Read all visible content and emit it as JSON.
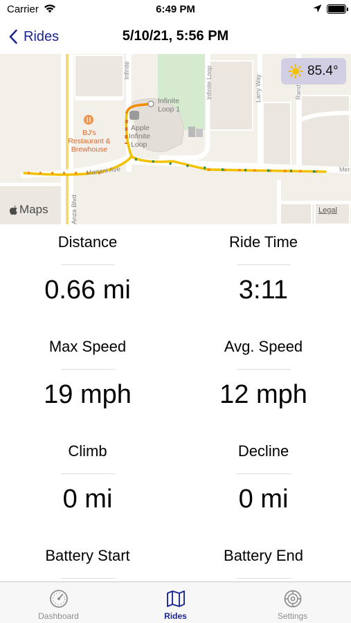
{
  "status_bar": {
    "carrier": "Carrier",
    "time": "6:49 PM",
    "icons": [
      "wifi-icon",
      "location-arrow-icon",
      "battery-icon"
    ]
  },
  "nav": {
    "back_label": "Rides",
    "title": "5/10/21, 5:56 PM",
    "accent_color": "#1c2690"
  },
  "map": {
    "weather": {
      "icon": "sun-icon",
      "temperature": "85.4°"
    },
    "labels": {
      "poi": "BJ's Restaurant & Brewhouse",
      "poi_lines": [
        "BJ's",
        "Restaurant &",
        "Brewhouse"
      ],
      "campus_lines": [
        "Apple",
        "Infinite",
        "Loop"
      ],
      "building": "Infinite Loop 1",
      "building_lines": [
        "Infinite",
        "Loop 1"
      ],
      "street_infinite_loop": "Infinite Loop",
      "street_infinite_left": "Infinite",
      "street_larry_way": "Larry Way",
      "street_randy": "Randy",
      "street_mariani": "Mariani Ave",
      "street_anza": "Anza Blvd",
      "street_mer": "Mer"
    },
    "branding": "Maps",
    "legal": "Legal",
    "route_colors": [
      "#f2c200",
      "#f28c00",
      "#2e8b3e",
      "#e03a1e"
    ]
  },
  "stats": [
    {
      "label": "Distance",
      "value": "0.66 mi"
    },
    {
      "label": "Ride Time",
      "value": "3:11"
    },
    {
      "label": "Max Speed",
      "value": "19 mph"
    },
    {
      "label": "Avg. Speed",
      "value": "12 mph"
    },
    {
      "label": "Climb",
      "value": "0 mi"
    },
    {
      "label": "Decline",
      "value": "0 mi"
    },
    {
      "label": "Battery Start",
      "value": ""
    },
    {
      "label": "Battery End",
      "value": ""
    }
  ],
  "tabs": [
    {
      "label": "Dashboard",
      "icon": "speedometer-icon",
      "active": false
    },
    {
      "label": "Rides",
      "icon": "map-icon",
      "active": true
    },
    {
      "label": "Settings",
      "icon": "gear-icon",
      "active": false
    }
  ]
}
